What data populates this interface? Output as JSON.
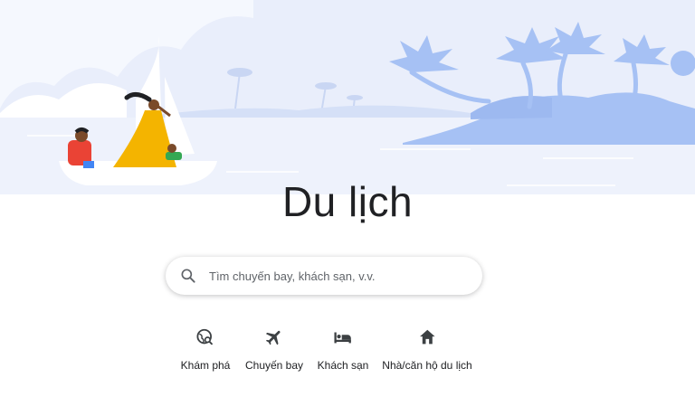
{
  "page": {
    "title": "Du lịch"
  },
  "search": {
    "placeholder": "Tìm chuyến bay, khách sạn, v.v."
  },
  "nav": [
    {
      "label": "Khám phá",
      "icon": "explore-globe-icon"
    },
    {
      "label": "Chuyến bay",
      "icon": "flight-icon"
    },
    {
      "label": "Khách sạn",
      "icon": "hotel-bed-icon"
    },
    {
      "label": "Nhà/căn hộ du lịch",
      "icon": "home-icon"
    }
  ],
  "colors": {
    "sky": "#e8eefb",
    "island": "#a5c1f5",
    "text": "#202124",
    "icon": "#5f6368"
  }
}
